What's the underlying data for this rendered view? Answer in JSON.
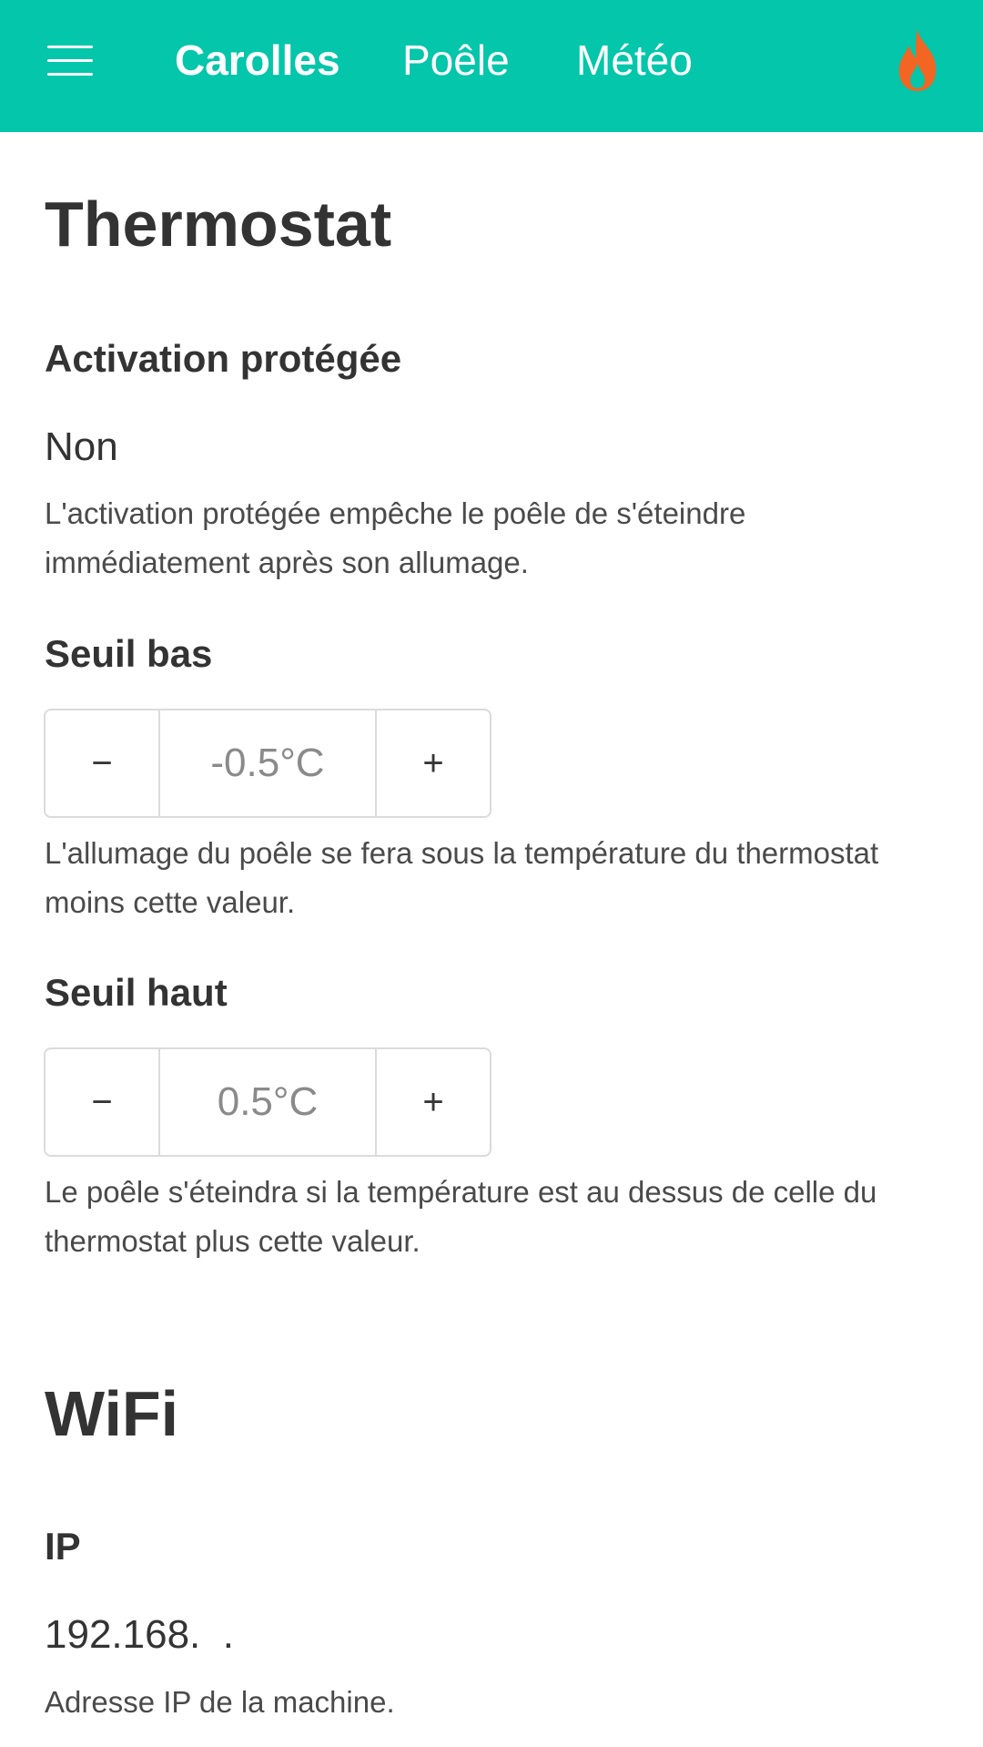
{
  "navbar": {
    "menu_icon": "hamburger-menu-icon",
    "brand": "Carolles",
    "items": [
      "Poêle",
      "Météo"
    ],
    "status_icon": "flame-icon",
    "background_color": "#03c6aa",
    "flame_color": "#f26522"
  },
  "thermostat": {
    "title": "Thermostat",
    "protected_activation": {
      "label": "Activation protégée",
      "value": "Non",
      "help": "L'activation protégée empêche le poêle de s'éteindre immédiatement après son allumage."
    },
    "low_threshold": {
      "label": "Seuil bas",
      "decrement_label": "−",
      "value": "-0.5°C",
      "increment_label": "+",
      "help": "L'allumage du poêle se fera sous la température du thermostat moins cette valeur."
    },
    "high_threshold": {
      "label": "Seuil haut",
      "decrement_label": "−",
      "value": "0.5°C",
      "increment_label": "+",
      "help": "Le poêle s'éteindra si la température est au dessus de celle du thermostat plus cette valeur."
    }
  },
  "wifi": {
    "title": "WiFi",
    "ip": {
      "label": "IP",
      "value": "192.168.  .",
      "help": "Adresse IP de la machine."
    }
  }
}
